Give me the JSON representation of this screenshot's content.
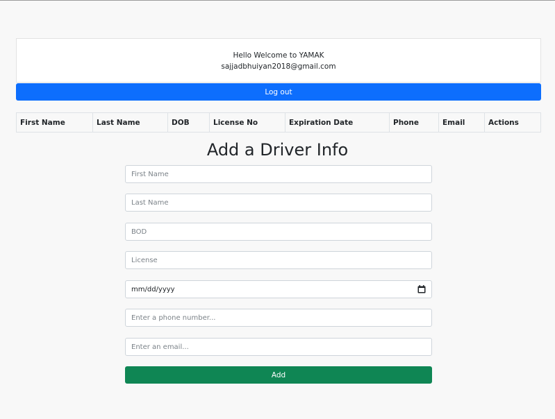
{
  "header": {
    "greeting": "Hello Welcome to YAMAK",
    "email": "sajjadbhuiyan2018@gmail.com",
    "logout_label": "Log out"
  },
  "table": {
    "columns": [
      "First Name",
      "Last Name",
      "DOB",
      "License No",
      "Expiration Date",
      "Phone",
      "Email",
      "Actions"
    ]
  },
  "form": {
    "title": "Add a Driver Info",
    "first_name_placeholder": "First Name",
    "last_name_placeholder": "Last Name",
    "bod_placeholder": "BOD",
    "license_placeholder": "License",
    "date_value": "mm/dd/yyyy",
    "phone_placeholder": "Enter a phone number...",
    "email_placeholder": "Enter an email...",
    "add_label": "Add"
  },
  "colors": {
    "primary": "#0d6efd",
    "success": "#0f8654",
    "background": "#f8f8f8"
  }
}
